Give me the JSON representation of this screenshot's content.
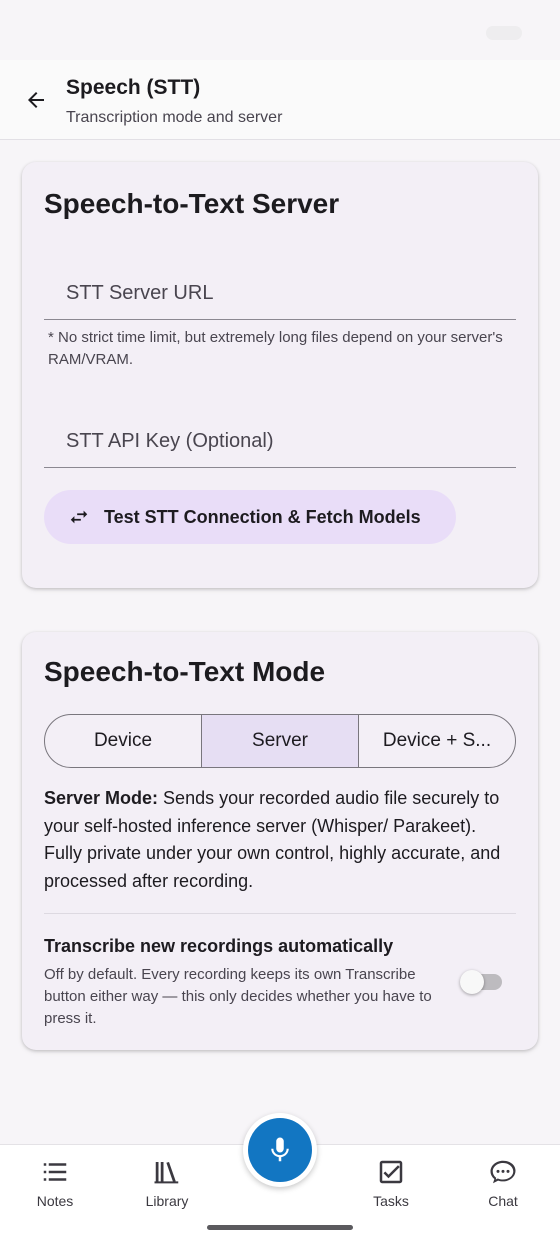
{
  "header": {
    "title": "Speech (STT)",
    "subtitle": "Transcription mode and server"
  },
  "server_card": {
    "title": "Speech-to-Text Server",
    "url_placeholder": "STT Server URL",
    "url_value": "",
    "helper_text": "* No strict time limit, but extremely long files depend on your server's RAM/VRAM.",
    "api_key_placeholder": "STT API Key (Optional)",
    "api_key_value": "",
    "test_button_label": "Test STT Connection & Fetch Models"
  },
  "mode_card": {
    "title": "Speech-to-Text Mode",
    "segments": [
      "Device",
      "Server",
      "Device + S..."
    ],
    "selected_segment": "Server",
    "description_bold": "Server Mode:",
    "description_rest": " Sends your recorded audio file securely to your self-hosted inference server (Whisper/ Parakeet). Fully private under your own control, highly accurate, and processed after recording.",
    "auto_transcribe_title": "Transcribe new recordings automatically",
    "auto_transcribe_desc": "Off by default. Every recording keeps its own Transcribe button either way — this only decides whether you have to press it.",
    "auto_transcribe_on": false
  },
  "bottom_nav": {
    "notes": "Notes",
    "library": "Library",
    "tasks": "Tasks",
    "chat": "Chat"
  },
  "colors": {
    "accent_fab": "#1276c2",
    "tonal_button": "#e9ddf8",
    "segment_selected": "#e6def3",
    "card_bg": "#f3eff6"
  },
  "icons": {
    "back": "arrow-left-icon",
    "test": "swap-arrows-icon",
    "fab": "microphone-icon",
    "notes": "list-icon",
    "library": "library-icon",
    "tasks": "checkbox-icon",
    "chat": "chat-bubble-icon"
  }
}
